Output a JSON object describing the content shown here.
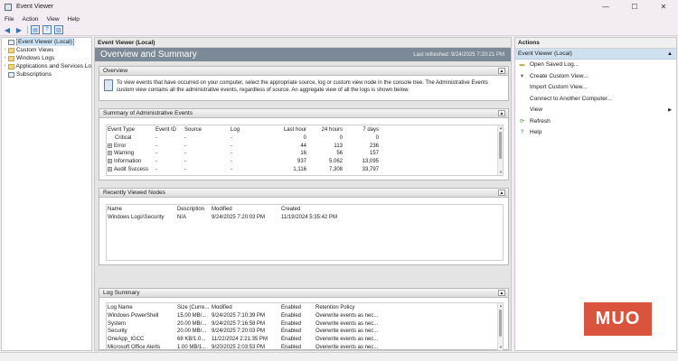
{
  "window": {
    "title": "Event Viewer",
    "controls": [
      "—",
      "☐",
      "✕"
    ]
  },
  "menu": [
    "File",
    "Action",
    "View",
    "Help"
  ],
  "tree": {
    "items": [
      {
        "label": "Event Viewer (Local)",
        "arrow": "",
        "selected": true
      },
      {
        "label": "Custom Views",
        "arrow": "›"
      },
      {
        "label": "Windows Logs",
        "arrow": "›"
      },
      {
        "label": "Applications and Services Lo",
        "arrow": "›"
      },
      {
        "label": "Subscriptions",
        "arrow": ""
      }
    ]
  },
  "center": {
    "header": "Event Viewer (Local)",
    "banner_title": "Overview and Summary",
    "last_refreshed": "Last refreshed: 9/24/2025 7:20:21 PM",
    "overview": {
      "title": "Overview",
      "text": "To view events that have occurred on your computer, select the appropriate source, log or custom view node in the console tree. The Administrative Events custom view contains all the administrative events, regardless of source. An aggregate view of all the logs is shown below."
    },
    "summary": {
      "title": "Summary of Administrative Events",
      "columns": [
        "Event Type",
        "Event ID",
        "Source",
        "Log",
        "Last hour",
        "24 hours",
        "7 days"
      ],
      "rows": [
        {
          "type": "Critical",
          "expand": "",
          "id": "-",
          "source": "-",
          "log": "-",
          "hour": "0",
          "day": "0",
          "week": "0"
        },
        {
          "type": "Error",
          "expand": "+",
          "id": "-",
          "source": "-",
          "log": "-",
          "hour": "44",
          "day": "113",
          "week": "236"
        },
        {
          "type": "Warning",
          "expand": "+",
          "id": "-",
          "source": "-",
          "log": "-",
          "hour": "16",
          "day": "56",
          "week": "157"
        },
        {
          "type": "Information",
          "expand": "+",
          "id": "-",
          "source": "-",
          "log": "-",
          "hour": "937",
          "day": "5,062",
          "week": "13,095"
        },
        {
          "type": "Audit Success",
          "expand": "+",
          "id": "-",
          "source": "-",
          "log": "-",
          "hour": "1,116",
          "day": "7,308",
          "week": "33,797"
        }
      ]
    },
    "recent": {
      "title": "Recently Viewed Nodes",
      "columns": [
        "Name",
        "Description",
        "Modified",
        "Created"
      ],
      "rows": [
        {
          "name": "Windows Logs\\Security",
          "desc": "N/A",
          "modified": "9/24/2025 7:20:03 PM",
          "created": "11/19/2024 5:35:42 PM"
        }
      ]
    },
    "logs": {
      "title": "Log Summary",
      "columns": [
        "Log Name",
        "Size (Curre...",
        "Modified",
        "Enabled",
        "Retention Policy"
      ],
      "rows": [
        {
          "name": "Windows PowerShell",
          "size": "15.00 MB/...",
          "modified": "9/24/2025 7:10:39 PM",
          "enabled": "Enabled",
          "policy": "Overwrite events as nec..."
        },
        {
          "name": "System",
          "size": "20.00 MB/...",
          "modified": "9/24/2025 7:16:58 PM",
          "enabled": "Enabled",
          "policy": "Overwrite events as nec..."
        },
        {
          "name": "Security",
          "size": "20.00 MB/...",
          "modified": "9/24/2025 7:20:03 PM",
          "enabled": "Enabled",
          "policy": "Overwrite events as nec..."
        },
        {
          "name": "OneApp_IGCC",
          "size": "68 KB/1.0...",
          "modified": "11/22/2024 2:21:35 PM",
          "enabled": "Enabled",
          "policy": "Overwrite events as nec..."
        },
        {
          "name": "Microsoft Office Alerts",
          "size": "1.00 MB/1...",
          "modified": "9/20/2025 2:03:53 PM",
          "enabled": "Enabled",
          "policy": "Overwrite events as nec..."
        }
      ]
    }
  },
  "actions": {
    "header": "Actions",
    "sub_header": "Event Viewer (Local)",
    "items": [
      {
        "label": "Open Saved Log...",
        "icon": "folder-icon",
        "glyph": "▬",
        "tone": "gold"
      },
      {
        "label": "Create Custom View...",
        "icon": "filter-icon",
        "glyph": "▼",
        "tone": ""
      },
      {
        "label": "Import Custom View...",
        "icon": "",
        "glyph": "",
        "tone": ""
      },
      {
        "label": "Connect to Another Computer...",
        "icon": "",
        "glyph": "",
        "tone": ""
      },
      {
        "label": "View",
        "icon": "",
        "glyph": "",
        "tone": "",
        "submenu": true
      },
      {
        "label": "Refresh",
        "icon": "refresh-icon",
        "glyph": "⟳",
        "tone": "green"
      },
      {
        "label": "Help",
        "icon": "help-icon",
        "glyph": "?",
        "tone": "blue"
      }
    ]
  },
  "watermark": "MUO"
}
